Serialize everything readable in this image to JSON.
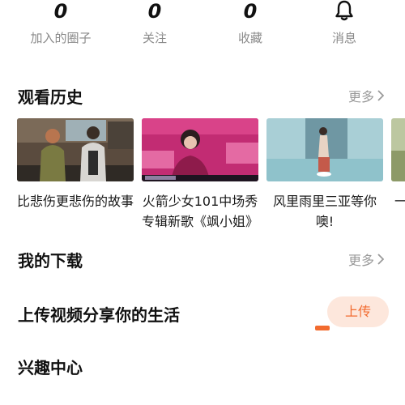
{
  "stats": [
    {
      "value": "0",
      "label": "加入的圈子"
    },
    {
      "value": "0",
      "label": "关注"
    },
    {
      "value": "0",
      "label": "收藏"
    },
    {
      "value": "",
      "label": "消息",
      "icon": "bell-icon"
    }
  ],
  "history": {
    "title": "观看历史",
    "more_label": "更多",
    "videos": [
      {
        "title": "比悲伤更悲伤的故事"
      },
      {
        "title": "火箭少女101中场秀专辑新歌《飒小姐》"
      },
      {
        "title": "风里雨里三亚等你噢!"
      },
      {
        "title": "一儿"
      }
    ]
  },
  "downloads": {
    "title": "我的下载",
    "more_label": "更多"
  },
  "upload": {
    "title": "上传视频分享你的生活",
    "button_label": "上传"
  },
  "interest": {
    "title": "兴趣中心"
  },
  "colors": {
    "accent": "#f26b2f",
    "accent_bg": "#fde7dc",
    "muted": "#9a9a9a"
  }
}
